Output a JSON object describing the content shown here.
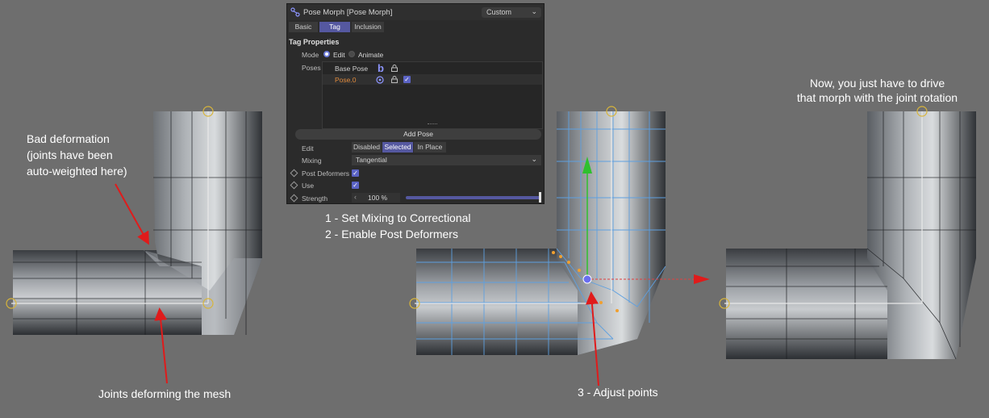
{
  "panel": {
    "title": "Pose Morph [Pose Morph]",
    "preset": "Custom",
    "tabs": [
      "Basic",
      "Tag",
      "Inclusion"
    ],
    "active_tab": "Tag",
    "section_title": "Tag Properties",
    "mode": {
      "label": "Mode",
      "options": [
        "Edit",
        "Animate"
      ],
      "selected": "Edit"
    },
    "poses": {
      "label": "Poses",
      "items": [
        {
          "name": "Base Pose",
          "icon": "b",
          "locked": true,
          "checked": false
        },
        {
          "name": "Pose.0",
          "icon": "target-icon",
          "locked": true,
          "checked": true
        }
      ]
    },
    "add_pose_button": "Add Pose",
    "edit": {
      "label": "Edit",
      "options": [
        "Disabled",
        "Selected",
        "In Place"
      ],
      "selected": "Selected"
    },
    "mixing": {
      "label": "Mixing",
      "value": "Tangential"
    },
    "post_deformers": {
      "label": "Post Deformers",
      "checked": true
    },
    "use": {
      "label": "Use",
      "checked": true
    },
    "strength": {
      "label": "Strength",
      "value": "100 %",
      "level": 1.0
    },
    "colors": {
      "accent": "#5558a0",
      "background": "#2b2b2b",
      "active_pose": "#e08a3c"
    }
  },
  "annotations": {
    "bad_deformation": [
      "Bad deformation",
      "(joints have been",
      "auto-weighted here)"
    ],
    "joints_deforming": "Joints deforming the mesh",
    "step1": "1 - Set Mixing to Correctional",
    "step2": "2 - Enable Post Deformers",
    "step3": "3 - Adjust points",
    "now_drive": [
      "Now, you just have to drive",
      "that morph with the joint rotation"
    ]
  },
  "colors": {
    "viewport_bg": "#6e6e6e",
    "arrow": "#e01b1b",
    "text": "#ffffff"
  }
}
